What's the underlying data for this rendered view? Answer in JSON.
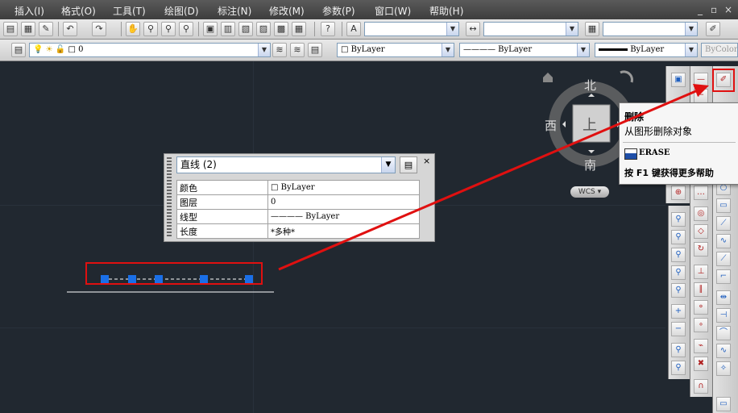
{
  "menu": {
    "items": [
      "插入(I)",
      "格式(O)",
      "工具(T)",
      "绘图(D)",
      "标注(N)",
      "修改(M)",
      "参数(P)",
      "窗口(W)",
      "帮助(H)"
    ],
    "window_controls": [
      "_",
      "▫",
      "×"
    ]
  },
  "toolbar": {
    "layer_value": "0",
    "color_value": "ByLayer",
    "linetype_value": "———— ByLayer",
    "lineweight_value": "ByLayer",
    "plotstyle_value": "ByColor",
    "text_style_value": "",
    "dim_style_value": "",
    "table_style_value": ""
  },
  "tooltip": {
    "title": "删除",
    "description": "从图形删除对象",
    "command": "ERASE",
    "help_hint": "按 F1 键获得更多帮助"
  },
  "quick_properties": {
    "selection": "直线 (2)",
    "close_label": "×",
    "rows": [
      {
        "key": "颜色",
        "value": "ByLayer"
      },
      {
        "key": "图层",
        "value": "0"
      },
      {
        "key": "线型",
        "value": "———— ByLayer"
      },
      {
        "key": "长度",
        "value": "*多种*"
      }
    ]
  },
  "viewcube": {
    "north": "北",
    "south": "南",
    "west": "西",
    "face": "上",
    "wcs": "WCS"
  },
  "colors": {
    "canvas": "#212830",
    "grip": "#1a6fe8",
    "annotation_red": "#e01010"
  }
}
